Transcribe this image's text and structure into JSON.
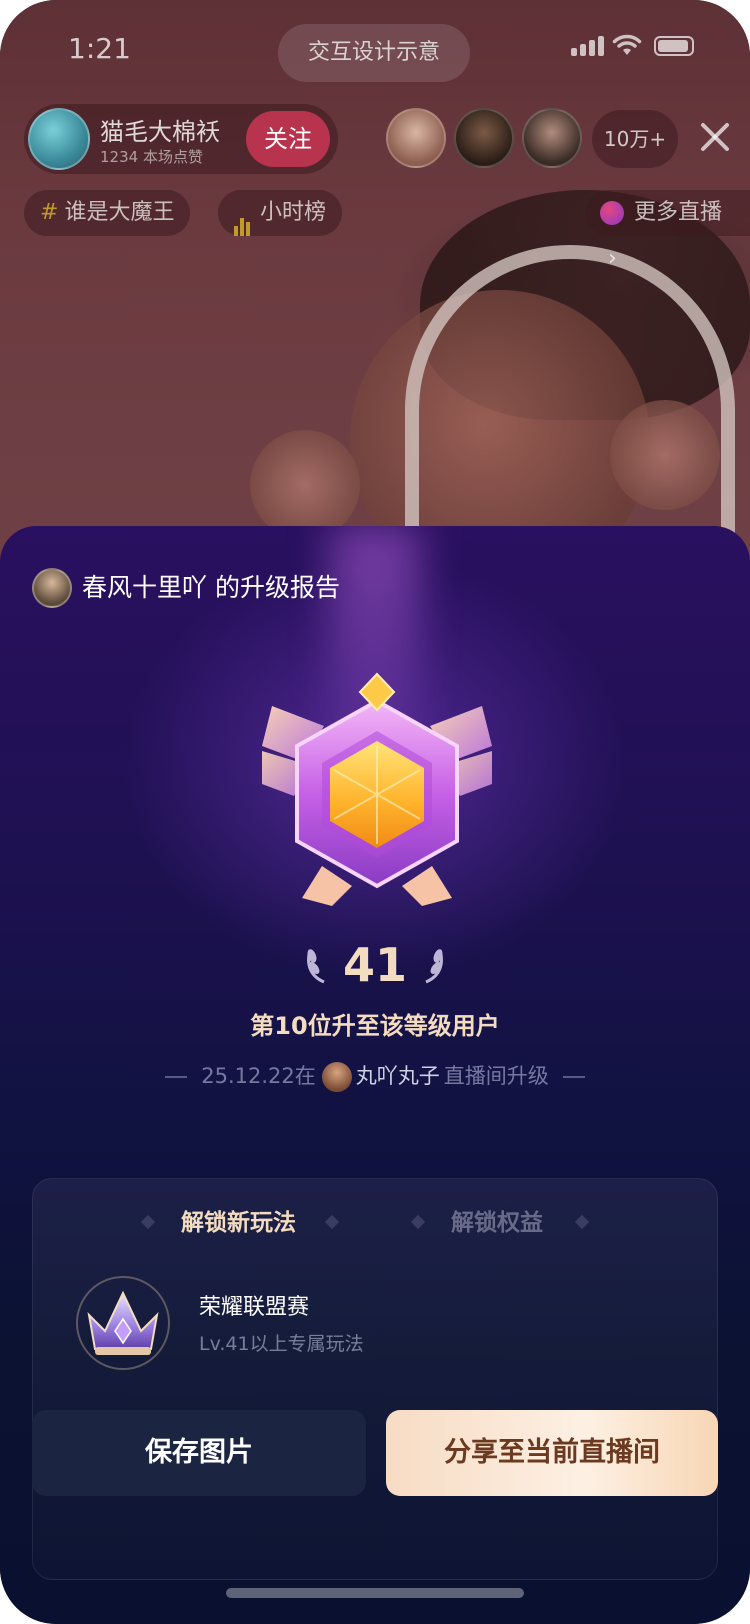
{
  "status_bar": {
    "time": "1:21",
    "center_pill": "交互设计示意"
  },
  "host": {
    "name": "猫毛大棉袄",
    "stats": "1234 本场点赞",
    "follow_label": "关注"
  },
  "viewers": {
    "count_label": "10万+"
  },
  "tags": [
    {
      "icon": "hashtag-icon",
      "label": "谁是大魔王"
    },
    {
      "icon": "chart-bars-icon",
      "label": "小时榜"
    }
  ],
  "more_live": {
    "label": "更多直播",
    "chevron": "›"
  },
  "report": {
    "title": "春风十里吖 的升级报告",
    "level": "41",
    "rank_text": "第10位升至该等级用户",
    "date_prefix": "25.12.22在",
    "room_owner": "丸吖丸子",
    "date_suffix": "直播间升级"
  },
  "card": {
    "tabs": [
      {
        "label": "解锁新玩法",
        "active": true
      },
      {
        "label": "解锁权益",
        "active": false
      }
    ],
    "unlock": {
      "title": "荣耀联盟赛",
      "subtitle": "Lv.41以上专属玩法"
    }
  },
  "actions": {
    "save_label": "保存图片",
    "share_label": "分享至当前直播间"
  },
  "colors": {
    "accent_gold": "#f3dcc0",
    "follow_red": "#b8344e",
    "panel_purple": "#2a1060"
  }
}
